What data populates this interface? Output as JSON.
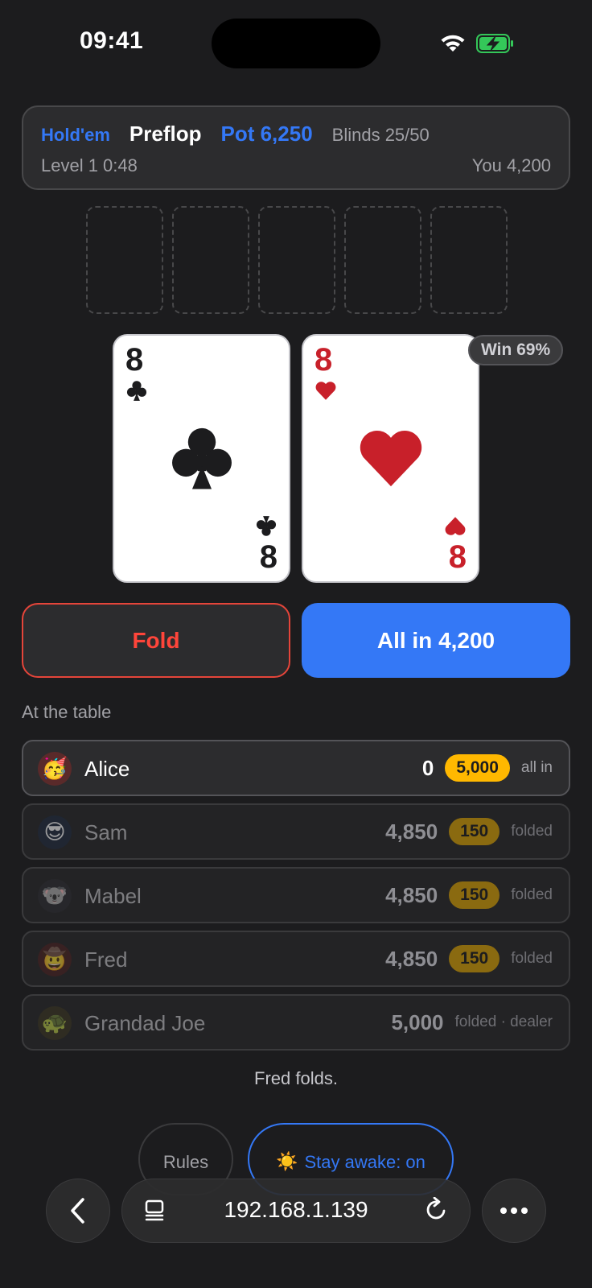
{
  "status_bar": {
    "time": "09:41"
  },
  "header": {
    "game_type": "Hold'em",
    "street": "Preflop",
    "pot": "Pot 6,250",
    "blinds": "Blinds 25/50",
    "level": "Level 1 0:48",
    "you_stack": "You 4,200"
  },
  "board": {
    "slots": 5
  },
  "hole_cards": [
    {
      "rank": "8",
      "suit": "clubs",
      "color": "#1c1c1e"
    },
    {
      "rank": "8",
      "suit": "hearts",
      "color": "#c8202a"
    }
  ],
  "win_badge": "Win 69%",
  "actions": {
    "fold_label": "Fold",
    "allin_label": "All in 4,200"
  },
  "table_section_label": "At the table",
  "players": [
    {
      "name": "Alice",
      "avatar": "🥳",
      "stack": "0",
      "bet": "5,000",
      "status": "all in"
    },
    {
      "name": "Sam",
      "avatar": "😎",
      "stack": "4,850",
      "bet": "150",
      "status": "folded"
    },
    {
      "name": "Mabel",
      "avatar": "🐨",
      "stack": "4,850",
      "bet": "150",
      "status": "folded"
    },
    {
      "name": "Fred",
      "avatar": "🤠",
      "stack": "4,850",
      "bet": "150",
      "status": "folded"
    },
    {
      "name": "Grandad Joe",
      "avatar": "🐢",
      "stack": "5,000",
      "bet": "",
      "status": "folded · dealer"
    }
  ],
  "last_action": "Fred folds.",
  "bottom_buttons": {
    "rules_label": "Rules",
    "awake_label": "Stay awake: on",
    "awake_icon": "☀️"
  },
  "browser": {
    "url": "192.168.1.139"
  },
  "colors": {
    "accent": "#3478f6",
    "fold": "#ff453a",
    "chip": "#ffb800",
    "heart": "#c8202a"
  }
}
